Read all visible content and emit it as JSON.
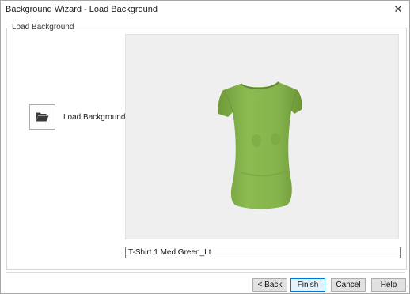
{
  "window": {
    "title": "Background Wizard - Load Background",
    "close_glyph": "✕"
  },
  "group": {
    "legend": "Load Background",
    "load_button_icon": "folder-open-icon",
    "load_label": "Load Background"
  },
  "preview": {
    "image": "t-shirt-green",
    "shirt_color": "#84b24a"
  },
  "background_name": {
    "value": "T-Shirt 1 Med Green_Lt"
  },
  "buttons": {
    "back": "< Back",
    "finish": "Finish",
    "cancel": "Cancel",
    "help": "Help"
  }
}
